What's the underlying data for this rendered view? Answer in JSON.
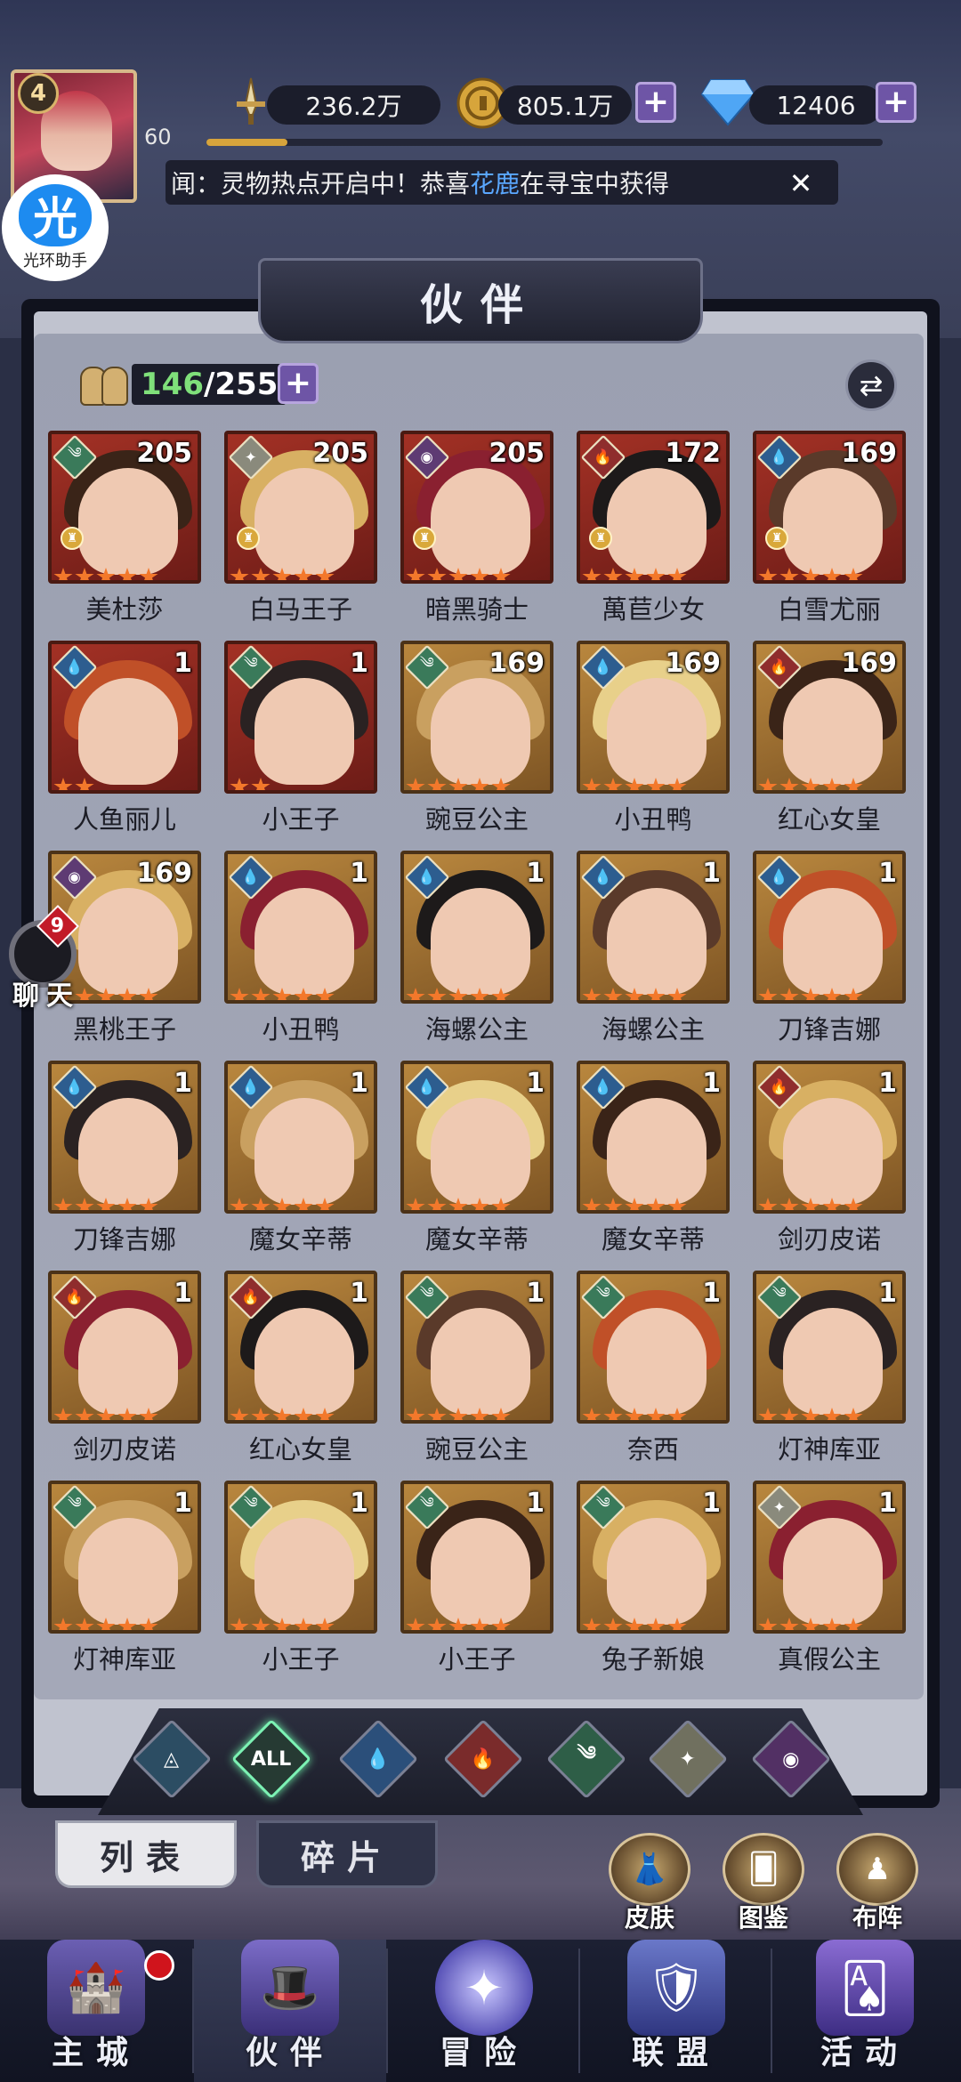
{
  "player": {
    "level": "4",
    "exp_value": "60",
    "exp_progress": 0.12
  },
  "helper": {
    "glyph": "光",
    "label": "光环助手"
  },
  "resources": {
    "power": "236.2万",
    "gold": "805.1万",
    "diamonds": "12406"
  },
  "marquee": {
    "prefix": "闻：灵物热点开启中！恭喜",
    "highlight": "花鹿",
    "suffix": "在寻宝中获得"
  },
  "panel": {
    "title": "伙伴"
  },
  "roster": {
    "current": "146",
    "total": "/255"
  },
  "heroes": [
    {
      "name": "美杜莎",
      "level": "205",
      "element": "wind",
      "stars": 5,
      "crown": true,
      "tone": "red"
    },
    {
      "name": "白马王子",
      "level": "205",
      "element": "light",
      "stars": 5,
      "crown": true,
      "tone": "red"
    },
    {
      "name": "暗黑骑士",
      "level": "205",
      "element": "dark",
      "stars": 5,
      "crown": true,
      "tone": "red"
    },
    {
      "name": "萬苣少女",
      "level": "172",
      "element": "fire",
      "stars": 5,
      "crown": true,
      "tone": "red"
    },
    {
      "name": "白雪尤丽",
      "level": "169",
      "element": "water",
      "stars": 5,
      "crown": true,
      "tone": "red"
    },
    {
      "name": "人鱼丽儿",
      "level": "1",
      "element": "water",
      "stars": 2,
      "crown": false,
      "tone": "red"
    },
    {
      "name": "小王子",
      "level": "1",
      "element": "wind",
      "stars": 2,
      "crown": false,
      "tone": "red"
    },
    {
      "name": "豌豆公主",
      "level": "169",
      "element": "wind",
      "stars": 5,
      "crown": false,
      "tone": "gold"
    },
    {
      "name": "小丑鸭",
      "level": "169",
      "element": "water",
      "stars": 5,
      "crown": false,
      "tone": "gold"
    },
    {
      "name": "红心女皇",
      "level": "169",
      "element": "fire",
      "stars": 5,
      "crown": false,
      "tone": "gold"
    },
    {
      "name": "黑桃王子",
      "level": "169",
      "element": "dark",
      "stars": 5,
      "crown": false,
      "tone": "gold"
    },
    {
      "name": "小丑鸭",
      "level": "1",
      "element": "water",
      "stars": 5,
      "crown": false,
      "tone": "gold"
    },
    {
      "name": "海螺公主",
      "level": "1",
      "element": "water",
      "stars": 5,
      "crown": false,
      "tone": "gold"
    },
    {
      "name": "海螺公主",
      "level": "1",
      "element": "water",
      "stars": 5,
      "crown": false,
      "tone": "gold"
    },
    {
      "name": "刀锋吉娜",
      "level": "1",
      "element": "water",
      "stars": 5,
      "crown": false,
      "tone": "gold"
    },
    {
      "name": "刀锋吉娜",
      "level": "1",
      "element": "water",
      "stars": 5,
      "crown": false,
      "tone": "gold"
    },
    {
      "name": "魔女辛蒂",
      "level": "1",
      "element": "water",
      "stars": 5,
      "crown": false,
      "tone": "gold"
    },
    {
      "name": "魔女辛蒂",
      "level": "1",
      "element": "water",
      "stars": 5,
      "crown": false,
      "tone": "gold"
    },
    {
      "name": "魔女辛蒂",
      "level": "1",
      "element": "water",
      "stars": 5,
      "crown": false,
      "tone": "gold"
    },
    {
      "name": "剑刃皮诺",
      "level": "1",
      "element": "fire",
      "stars": 5,
      "crown": false,
      "tone": "gold"
    },
    {
      "name": "剑刃皮诺",
      "level": "1",
      "element": "fire",
      "stars": 5,
      "crown": false,
      "tone": "gold"
    },
    {
      "name": "红心女皇",
      "level": "1",
      "element": "fire",
      "stars": 5,
      "crown": false,
      "tone": "gold"
    },
    {
      "name": "豌豆公主",
      "level": "1",
      "element": "wind",
      "stars": 5,
      "crown": false,
      "tone": "gold"
    },
    {
      "name": "奈西",
      "level": "1",
      "element": "wind",
      "stars": 5,
      "crown": false,
      "tone": "gold"
    },
    {
      "name": "灯神库亚",
      "level": "1",
      "element": "wind",
      "stars": 5,
      "crown": false,
      "tone": "gold"
    },
    {
      "name": "灯神库亚",
      "level": "1",
      "element": "wind",
      "stars": 5,
      "crown": false,
      "tone": "gold"
    },
    {
      "name": "小王子",
      "level": "1",
      "element": "wind",
      "stars": 5,
      "crown": false,
      "tone": "gold"
    },
    {
      "name": "小王子",
      "level": "1",
      "element": "wind",
      "stars": 5,
      "crown": false,
      "tone": "gold"
    },
    {
      "name": "兔子新娘",
      "level": "1",
      "element": "wind",
      "stars": 5,
      "crown": false,
      "tone": "gold"
    },
    {
      "name": "真假公主",
      "level": "1",
      "element": "light",
      "stars": 5,
      "crown": false,
      "tone": "gold"
    }
  ],
  "filters": [
    {
      "id": "filter-tab-earth",
      "label": "",
      "icon": "earth-icon"
    },
    {
      "id": "filter-tab-all",
      "label": "ALL",
      "icon": ""
    },
    {
      "id": "filter-tab-water",
      "label": "",
      "icon": "water-drop-icon"
    },
    {
      "id": "filter-tab-fire",
      "label": "",
      "icon": "flame-icon"
    },
    {
      "id": "filter-tab-wind",
      "label": "",
      "icon": "wind-icon"
    },
    {
      "id": "filter-tab-light",
      "label": "",
      "icon": "light-star-icon"
    },
    {
      "id": "filter-tab-dark",
      "label": "",
      "icon": "dark-eye-icon"
    }
  ],
  "tabs": {
    "list": "列表",
    "fragments": "碎片"
  },
  "side_buttons": {
    "skin": "皮肤",
    "codex": "图鉴",
    "formation": "布阵"
  },
  "chat": {
    "badge": "9",
    "label": "聊天"
  },
  "nav": {
    "city": "主城",
    "partner": "伙伴",
    "adventure": "冒险",
    "alliance": "联盟",
    "event": "活动"
  },
  "colors": {
    "wind": "#3a7a5a",
    "water": "#2d5d8f",
    "fire": "#8f2d2d",
    "light": "#8a8a7c",
    "dark": "#5e3b73",
    "earth": "#3a5a6a"
  }
}
